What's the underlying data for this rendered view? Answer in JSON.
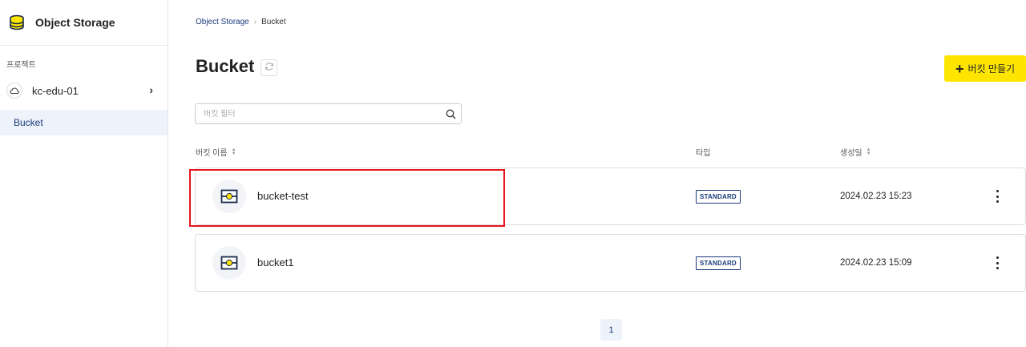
{
  "sidebar": {
    "app_title": "Object Storage",
    "app_icon": "database-icon",
    "section_label": "프로젝트",
    "project": {
      "name": "kc-edu-01",
      "icon": "cloud-icon",
      "chevron": "›"
    },
    "nav": [
      {
        "label": "Bucket",
        "active": true
      }
    ]
  },
  "breadcrumb": {
    "items": [
      "Object Storage",
      "Bucket"
    ],
    "separator": "›"
  },
  "page": {
    "title": "Bucket",
    "create_button_label": "버킷 만들기",
    "create_button_icon": "plus-icon",
    "accent_color": "#fee500"
  },
  "search": {
    "placeholder": "버킷 필터",
    "value": ""
  },
  "table": {
    "columns": [
      {
        "label": "버킷 이름",
        "sortable": true
      },
      {
        "label": "타입",
        "sortable": false
      },
      {
        "label": "생성일",
        "sortable": true
      }
    ],
    "rows": [
      {
        "name": "bucket-test",
        "type": "STANDARD",
        "created": "2024.02.23 15:23",
        "highlighted": true
      },
      {
        "name": "bucket1",
        "type": "STANDARD",
        "created": "2024.02.23 15:09",
        "highlighted": false
      }
    ]
  },
  "pagination": {
    "current": "1"
  },
  "colors": {
    "accent": "#fee500",
    "primary": "#1a3a7a",
    "highlight": "#e8141a"
  }
}
